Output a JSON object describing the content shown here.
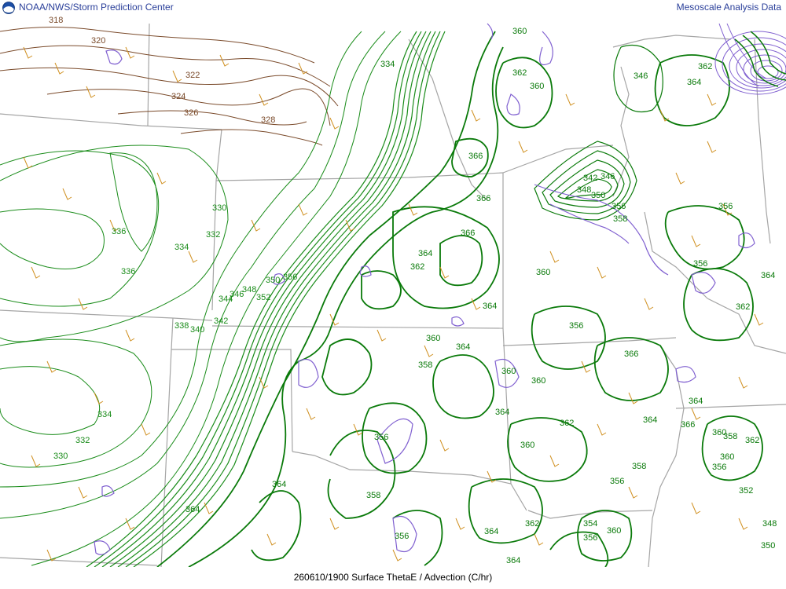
{
  "header": {
    "left_title": "NOAA/NWS/Storm Prediction Center",
    "right_title": "Mesoscale Analysis Data"
  },
  "footer": {
    "caption": "260610/1900 Surface ThetaE / Advection (C/hr)"
  },
  "colors": {
    "thetae_cold": "#7a4a2a",
    "thetae_mid": "#1a8c1a",
    "thetae_warm": "#0a7a0a",
    "advection": "#8060d0",
    "boundaries": "#a0a0a0",
    "wind_barbs": "#d09020",
    "title_text": "#2a3f9a"
  },
  "contour_labels": {
    "brown": [
      "318",
      "320",
      "322",
      "324",
      "326",
      "328"
    ],
    "green_west": [
      "330",
      "336",
      "332",
      "334",
      "336",
      "338",
      "340",
      "342",
      "344",
      "346",
      "348",
      "350",
      "352",
      "356",
      "334",
      "332",
      "330"
    ],
    "green_east": [
      "334",
      "346",
      "360",
      "362",
      "360",
      "366",
      "366",
      "366",
      "364",
      "362",
      "342",
      "346",
      "348",
      "350",
      "356",
      "358",
      "360",
      "364",
      "364",
      "360",
      "358",
      "364",
      "360",
      "360",
      "364",
      "362",
      "356",
      "360",
      "356",
      "366",
      "364",
      "358",
      "356",
      "364",
      "356",
      "352",
      "362",
      "364",
      "360",
      "356",
      "354",
      "348",
      "350",
      "360",
      "356",
      "358",
      "362",
      "364",
      "366",
      "360",
      "358",
      "356",
      "362",
      "364",
      "362",
      "364",
      "356",
      "364"
    ]
  }
}
